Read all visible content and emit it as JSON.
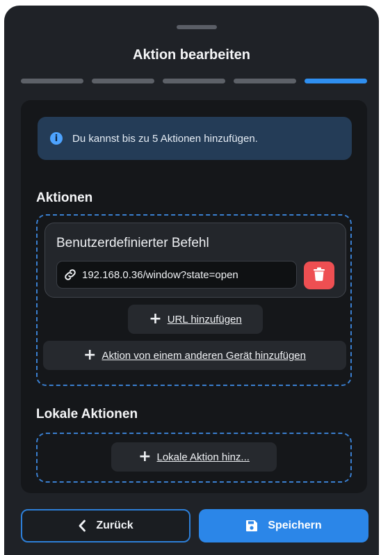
{
  "dialog": {
    "title": "Aktion bearbeiten",
    "steps_total": 5,
    "step_current": 5
  },
  "info": {
    "icon": "info-icon",
    "text": "Du kannst bis zu 5 Aktionen hinzufügen."
  },
  "actions": {
    "heading": "Aktionen",
    "items": [
      {
        "title": "Benutzerdefinierter Befehl",
        "url": "192.168.0.36/window?state=open",
        "icon": "link-icon",
        "delete_icon": "trash-icon"
      }
    ],
    "add_url_label": "URL hinzufügen",
    "add_device_action_label": "Aktion von einem anderen Gerät hinzufügen"
  },
  "local_actions": {
    "heading": "Lokale Aktionen",
    "add_label": "Lokale Aktion hinz..."
  },
  "footer": {
    "back_label": "Zurück",
    "save_label": "Speichern"
  },
  "colors": {
    "accent": "#2f8ff0",
    "danger": "#ee4f52",
    "background": "#1f2227",
    "info_background": "#243c57"
  }
}
